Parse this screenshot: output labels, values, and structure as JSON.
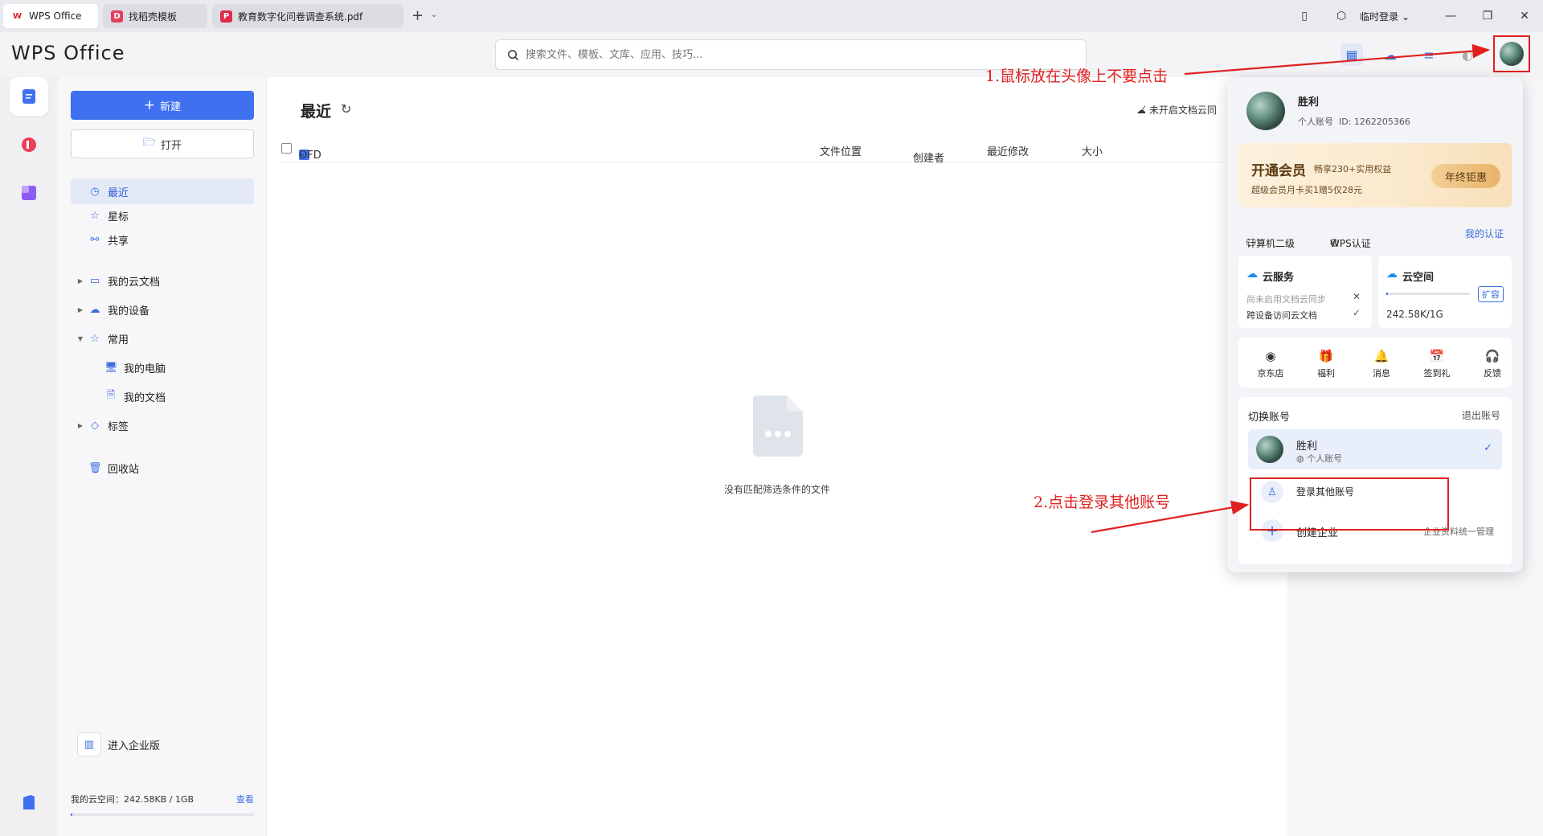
{
  "tabs": [
    {
      "label": "WPS Office",
      "icon": "wps-logo-icon",
      "color": "#e02020"
    },
    {
      "label": "找稻壳模板",
      "icon": "docer-icon",
      "color": "#e0405a"
    },
    {
      "label": "教育数字化问卷调查系统.pdf",
      "icon": "pdf-icon",
      "color": "#e02a4a"
    }
  ],
  "titlebar": {
    "login_temp": "临时登录"
  },
  "header": {
    "logo": "WPS Office",
    "search_placeholder": "搜索文件、模板、文库、应用、技巧..."
  },
  "sidebar": {
    "new_label": "新建",
    "open_label": "打开",
    "items": [
      {
        "label": "最近",
        "icon": "clock-icon",
        "selected": true
      },
      {
        "label": "星标",
        "icon": "star-icon"
      },
      {
        "label": "共享",
        "icon": "share-icon"
      },
      {
        "label": "我的云文档",
        "icon": "folder-icon"
      },
      {
        "label": "我的设备",
        "icon": "cloud-device-icon"
      },
      {
        "label": "常用",
        "icon": "pin-icon"
      },
      {
        "label": "我的电脑",
        "icon": "computer-icon"
      },
      {
        "label": "我的文档",
        "icon": "document-icon"
      },
      {
        "label": "标签",
        "icon": "tag-icon"
      },
      {
        "label": "回收站",
        "icon": "trash-icon"
      }
    ],
    "enterprise_label": "进入企业版",
    "storage_label": "我的云空间：242.58KB / 1GB",
    "storage_view": "查看",
    "storage_fraction": 0.0002
  },
  "main": {
    "title": "最近",
    "cloud_status": "未开启文档云同",
    "filter": "OFD",
    "columns": [
      "文件位置",
      "创建者",
      "最近修改",
      "大小"
    ],
    "empty_text": "没有匹配筛选条件的文件"
  },
  "popover": {
    "user_name": "胜利",
    "user_type": "个人账号",
    "user_id": "ID: 1262205366",
    "vip_title": "开通会员",
    "vip_benefit": "畅享230+实用权益",
    "vip_promo": "超级会员月卡买1赠5仅28元",
    "vip_button": "年终钜惠",
    "cert1": "计算机二级",
    "cert2": "WPS认证",
    "my_cert": "我的认证",
    "cloud_service_title": "云服务",
    "cloud_service_line1": "尚未启用文档云同步",
    "cloud_service_line2": "跨设备访问云文档",
    "cloud_space_title": "云空间",
    "cloud_space_expand": "扩容",
    "cloud_space_usage": "242.58K/1G",
    "quick_actions": [
      "京东店",
      "福利",
      "消息",
      "签到礼",
      "反馈"
    ],
    "switch_title": "切换账号",
    "logout": "退出账号",
    "account_name": "胜利",
    "account_type": "个人账号",
    "login_other": "登录其他账号",
    "create_enterprise": "创建企业",
    "enterprise_desc": "企业资料统一管理"
  },
  "annotations": {
    "step1": "1.鼠标放在头像上不要点击",
    "step2": "2.点击登录其他账号"
  },
  "colors": {
    "accent": "#3e70f0",
    "annotation": "#e02020",
    "vip_gold": "#e9b46a"
  }
}
